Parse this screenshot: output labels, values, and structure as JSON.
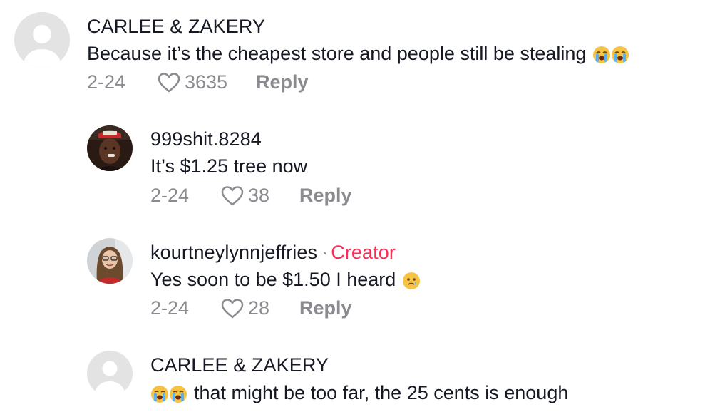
{
  "comments": [
    {
      "username": "CARLEE & ZAKERY",
      "text": "Because it’s the cheapest store and people still be stealing",
      "date": "2-24",
      "likes": "3635",
      "reply_label": "Reply",
      "emoji": [
        "loudly-crying-face",
        "loudly-crying-face"
      ]
    },
    {
      "username": "999shit.8284",
      "text": "It’s $1.25 tree now",
      "date": "2-24",
      "likes": "38",
      "reply_label": "Reply"
    },
    {
      "username": "kourtneylynnjeffries",
      "creator_separator": "·",
      "creator_label": "Creator",
      "text": "Yes soon to be $1.50 I heard",
      "date": "2-24",
      "likes": "28",
      "reply_label": "Reply",
      "emoji": [
        "face-holding-back-tears"
      ]
    },
    {
      "username": "CARLEE & ZAKERY",
      "text": "that might be too far, the 25 cents is enough",
      "emoji": [
        "loudly-crying-face",
        "loudly-crying-face"
      ]
    }
  ],
  "colors": {
    "primary_text": "#161823",
    "secondary_text": "#8a8b91",
    "creator": "#fe2c55",
    "avatar_placeholder_bg": "#e3e3e4"
  }
}
